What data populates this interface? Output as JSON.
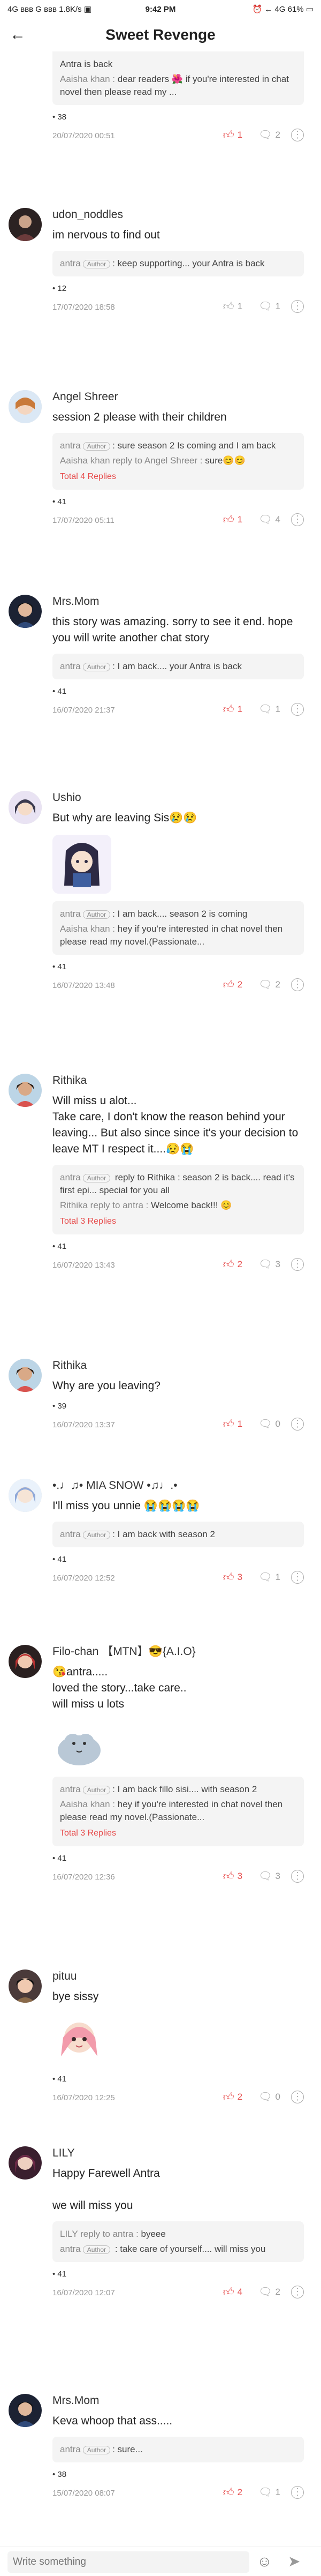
{
  "status": {
    "left": "4G ʙʙʙ G ʙʙʙ 1.8K/s ▣",
    "time": "9:42 PM",
    "right": "⏰ ← 4G 61% ▭"
  },
  "header": {
    "title": "Sweet Revenge"
  },
  "colors": {
    "accent": "#e74c4c",
    "muted": "#999999",
    "box": "#f4f4f4"
  },
  "comments": [
    {
      "name": "",
      "text": "",
      "replies": [
        {
          "a": "",
          "b": "Antra is back"
        },
        {
          "a": "Aaisha khan : ",
          "b": "dear readers 🌺 if you're interested in chat novel then please read my ..."
        }
      ],
      "total": "",
      "views": "• 38",
      "date": "20/07/2020 00:51",
      "likes": "1",
      "comments": "2"
    },
    {
      "name": "udon_noddles",
      "text": "im nervous to find out",
      "replies": [
        {
          "a": "antra",
          "author": "Author",
          "b": ": keep supporting... your Antra is back"
        }
      ],
      "total": "",
      "views": "• 12",
      "date": "17/07/2020 18:58",
      "likes": "1",
      "comments": "1"
    },
    {
      "name": "Angel Shreer",
      "text": "session 2 please with their children",
      "replies": [
        {
          "a": "antra",
          "author": "Author",
          "b": ": sure season 2 Is coming and I am back"
        },
        {
          "a": "Aaisha khan reply to Angel Shreer : ",
          "b": "sure😊😊"
        }
      ],
      "total": "Total 4 Replies",
      "views": "• 41",
      "date": "17/07/2020 05:11",
      "likes": "1",
      "comments": "4"
    },
    {
      "name": "Mrs.Mom",
      "text": "this story was amazing. sorry to see it end. hope you will write another chat story",
      "replies": [
        {
          "a": "antra",
          "author": "Author",
          "b": ": I am back.... your Antra is back"
        }
      ],
      "total": "",
      "views": "• 41",
      "date": "16/07/2020 21:37",
      "likes": "1",
      "comments": "1"
    },
    {
      "name": "Ushio",
      "text": "But why are leaving Sis😢😢",
      "replies": [
        {
          "a": "antra",
          "author": "Author",
          "b": ": I am back.... season 2 is coming"
        },
        {
          "a": "Aaisha khan : ",
          "b": "hey if you're interested in chat novel then please read my novel.(Passionate..."
        }
      ],
      "total": "",
      "views": "• 41",
      "date": "16/07/2020 13:48",
      "likes": "2",
      "comments": "2"
    },
    {
      "name": "Rithika",
      "text": "Will miss u alot...\nTake care, I don't know the reason behind your leaving... But also since since it's your decision to leave MT I  respect it....😥😭",
      "replies": [
        {
          "a": "antra",
          "author": "Author",
          "b": " reply to Rithika : season 2 is back.... read it's first epi... special for you all"
        },
        {
          "a": "Rithika reply to antra : ",
          "b": "Welcome back!!! 😊"
        }
      ],
      "total": "Total 3 Replies",
      "views": "• 41",
      "date": "16/07/2020 13:43",
      "likes": "2",
      "comments": "3"
    },
    {
      "name": "Rithika",
      "text": "Why are you leaving?",
      "replies": [],
      "total": "",
      "views": "• 39",
      "date": "16/07/2020 13:37",
      "likes": "1",
      "comments": "0"
    },
    {
      "name": "•.♩♫• MIA SNOW •♫♩.•",
      "text": "I'll miss you unnie 😭😭😭😭",
      "replies": [
        {
          "a": "antra",
          "author": "Author",
          "b": ": I am back with season 2"
        }
      ],
      "total": "",
      "views": "• 41",
      "date": "16/07/2020 12:52",
      "likes": "3",
      "comments": "1"
    },
    {
      "name": "Filo-chan 【MTN】😎{A.I.O}",
      "text": "😘antra.....\nloved the story...take care..\nwill miss u lots",
      "replies": [
        {
          "a": "antra",
          "author": "Author",
          "b": ": I am back fillo sisi.... with season 2"
        },
        {
          "a": "Aaisha khan : ",
          "b": "hey if you're interested in chat novel then please read my novel.(Passionate..."
        }
      ],
      "total": "Total 3 Replies",
      "views": "• 41",
      "date": "16/07/2020 12:36",
      "likes": "3",
      "comments": "3"
    },
    {
      "name": "pituu",
      "text": "bye sissy",
      "replies": [],
      "total": "",
      "views": "• 41",
      "date": "16/07/2020 12:25",
      "likes": "2",
      "comments": "0"
    },
    {
      "name": "LILY",
      "text": "Happy Farewell Antra\n\nwe will miss you",
      "replies": [
        {
          "a": "LILY reply to antra : ",
          "b": "byeee"
        },
        {
          "a": "antra",
          "author": "Author",
          "b": " : take care of yourself.... will miss you"
        }
      ],
      "total": "",
      "views": "• 41",
      "date": "16/07/2020 12:07",
      "likes": "4",
      "comments": "2"
    },
    {
      "name": "Mrs.Mom",
      "text": "Keva whoop that ass.....",
      "replies": [
        {
          "a": "antra",
          "author": "Author",
          "b": ": sure..."
        }
      ],
      "total": "",
      "views": "• 38",
      "date": "15/07/2020 08:07",
      "likes": "2",
      "comments": "1"
    }
  ],
  "input": {
    "placeholder": "Write something"
  }
}
